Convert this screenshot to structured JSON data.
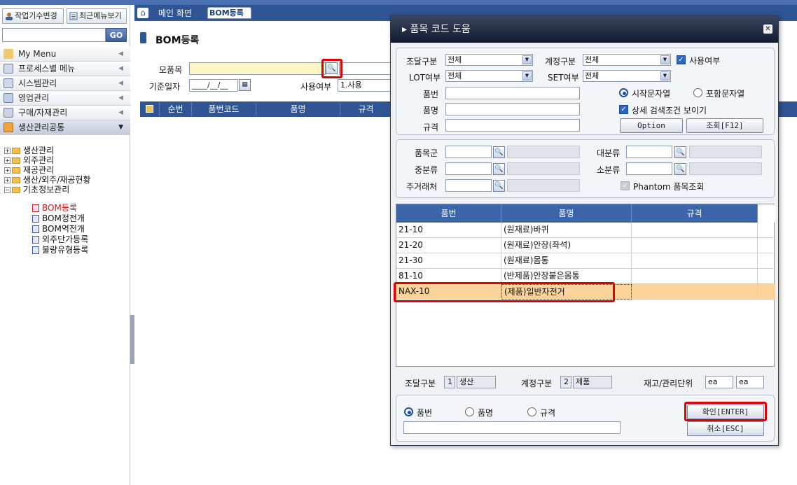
{
  "sidebar": {
    "btn_change": "작업기수변경",
    "btn_recent": "최근메뉴보기",
    "go": "GO",
    "menus": [
      "My Menu",
      "프로세스별 메뉴",
      "시스템관리",
      "영업관리",
      "구매/자재관리",
      "생산관리공통"
    ],
    "tree": {
      "folders": [
        "생산관리",
        "외주관리",
        "재공관리",
        "생산/외주/재공현황",
        "기초정보관리"
      ],
      "docs": [
        "BOM등록",
        "BOM정전개",
        "BOM역전개",
        "외주단가등록",
        "불량유형등록"
      ]
    }
  },
  "tabs": {
    "main": "메인 화면",
    "bom": "BOM등록"
  },
  "page": {
    "title": "BOM등록",
    "parent_label": "모품목",
    "date_label": "기준일자",
    "date_value": "____/__/__",
    "use_label": "사용여부",
    "use_value": "1.사용",
    "columns": [
      "순번",
      "품번코드",
      "품명",
      "규격"
    ]
  },
  "popup": {
    "title": "품목 코드 도움",
    "procure_label": "조달구분",
    "procure_value": "전체",
    "account_label": "계정구분",
    "account_value": "전체",
    "use_label": "사용여부",
    "lot_label": "LOT여부",
    "lot_value": "전체",
    "set_label": "SET여부",
    "set_value": "전체",
    "pn_label": "품번",
    "name_label": "품명",
    "spec_label": "규격",
    "radio_start": "시작문자열",
    "radio_contain": "포함문자열",
    "detail_label": "상세 검색조건 보이기",
    "option_btn": "Option",
    "search_btn": "조회[F12]",
    "group_label": "품목군",
    "major_label": "대분류",
    "middle_label": "중분류",
    "minor_label": "소분류",
    "customer_label": "주거래처",
    "phantom_label": "Phantom 품목조회",
    "table": {
      "headers": [
        "품번",
        "품명",
        "규격"
      ],
      "rows": [
        {
          "pn": "21-10",
          "name": "(원재료)바퀴",
          "spec": ""
        },
        {
          "pn": "21-20",
          "name": "(원재료)안장(좌석)",
          "spec": ""
        },
        {
          "pn": "21-30",
          "name": "(원재료)몸통",
          "spec": ""
        },
        {
          "pn": "81-10",
          "name": "(반제품)안장붙은몸통",
          "spec": ""
        },
        {
          "pn": "NAX-10",
          "name": "(제품)일반자전거",
          "spec": ""
        }
      ]
    },
    "info": {
      "procure_label": "조달구분",
      "procure_code": "1",
      "procure_name": "생산",
      "account_label": "계정구분",
      "account_code": "2",
      "account_name": "제품",
      "unit_label": "재고/관리단위",
      "unit1": "ea",
      "unit2": "ea"
    },
    "bottom": {
      "r1": "품번",
      "r2": "품명",
      "r3": "규격",
      "ok_btn": "확인[ENTER]",
      "cancel_btn": "취소[ESC]"
    }
  },
  "colors": {
    "accent": "#2f5594",
    "highlight_row": "#fbd39b",
    "mark": "#e00000"
  }
}
